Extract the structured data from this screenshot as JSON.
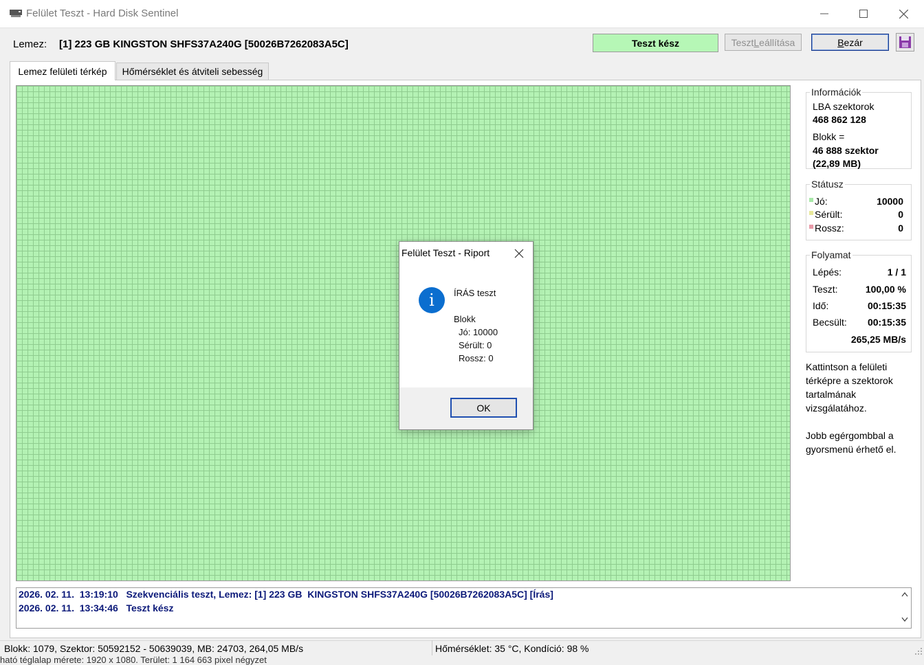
{
  "window": {
    "title": "Felület Teszt - Hard Disk Sentinel",
    "app_icon": "disk-icon",
    "minimize_icon": "minimize-icon",
    "maximize_icon": "maximize-icon",
    "close_icon": "close-icon"
  },
  "toolbar": {
    "disk_label": "Lemez:",
    "disk_name": "[1] 223 GB  KINGSTON SHFS37A240G [50026B7262083A5C]",
    "status": "Teszt kész",
    "status_color": "#b6f7b6",
    "stop_button": "Teszt Leállítása",
    "close_button": "Bezár",
    "save_icon": "save-icon"
  },
  "tabs": [
    {
      "label": "Lemez felületi térkép",
      "active": true
    },
    {
      "label": "Hőmérséklet és átviteli sebesség",
      "active": false
    }
  ],
  "map": {
    "block_color": "#b4f2b4",
    "grid_color": "#8fcc8f"
  },
  "info": {
    "title": "Információk",
    "lba_label": "LBA szektorok",
    "lba_value": "468 862 128",
    "block_label": "Blokk =",
    "block_value": "46 888 szektor",
    "block_mb": "(22,89 MB)"
  },
  "status": {
    "title": "Státusz",
    "good_label": "Jó:",
    "good_value": "10000",
    "damaged_label": "Sérült:",
    "damaged_value": "0",
    "bad_label": "Rossz:",
    "bad_value": "0",
    "good_color": "#a8e8a8",
    "damaged_color": "#e8e89a",
    "bad_color": "#e89aa8"
  },
  "progress": {
    "title": "Folyamat",
    "step_label": "Lépés:",
    "step_value": "1 / 1",
    "test_label": "Teszt:",
    "test_value": "100,00 %",
    "time_label": "Idő:",
    "time_value": "00:15:35",
    "est_label": "Becsült:",
    "est_value": "00:15:35",
    "speed": "265,25 MB/s"
  },
  "hint": {
    "line1": "Kattintson a felületi",
    "line2": "térképre a szektorok",
    "line3": "tartalmának",
    "line4": "vizsgálatához.",
    "line5": "Jobb egérgombbal a",
    "line6": "gyorsmenü érhető el."
  },
  "log": [
    "2026. 02. 11.  13:19:10   Szekvenciális teszt, Lemez: [1] 223 GB  KINGSTON SHFS37A240G [50026B7262083A5C] [Írás]",
    "2026. 02. 11.  13:34:46   Teszt kész"
  ],
  "statusbar": {
    "left": "Blokk: 1079, Szektor: 50592152 - 50639039, MB: 24703, 264,05 MB/s",
    "right": "Hőmérséklet: 35  °C,  Kondíció: 98 %",
    "under": "ható téglalap mérete: 1920 x 1080. Terület: 1 164 663 pixel négyzet"
  },
  "dialog": {
    "title": "Felület Teszt - Riport",
    "icon": "info-icon",
    "icon_glyph": "i",
    "heading": "ÍRÁS teszt",
    "block_label": "Blokk",
    "good": "Jó: 10000",
    "damaged": "Sérült: 0",
    "bad": "Rossz: 0",
    "ok_button": "OK"
  }
}
